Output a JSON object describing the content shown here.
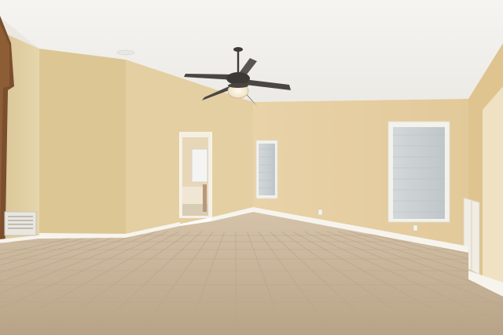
{
  "scene": {
    "type": "empty-room-photo",
    "room": "empty bedroom",
    "colors": {
      "ceiling": "#f2f1ee",
      "wall": "#e6cfa3",
      "wall_shadow": "#d8c190",
      "left_wall": "#ddc995",
      "baseboard": "#f7f4ee",
      "floor_light": "#cbb89e",
      "floor_dark": "#9e8c74",
      "grout": "#b8a68c",
      "window_frame": "#f4f2ec",
      "window_blind": "#c9d0d3",
      "fan_blade": "#4a4644",
      "fan_light": "#f7efd9",
      "vent": "#e9e6df",
      "doorway_tub": "#efe9dd"
    },
    "objects": [
      {
        "name": "ceiling-fan",
        "kind": "ceiling fan with light kit"
      },
      {
        "name": "window-left",
        "kind": "window with closed blind"
      },
      {
        "name": "window-right",
        "kind": "window with closed blind"
      },
      {
        "name": "doorway",
        "kind": "open doorway to bathroom"
      },
      {
        "name": "floor-vent",
        "kind": "wall air vent"
      },
      {
        "name": "closet-doors",
        "kind": "white closet bifold doors"
      },
      {
        "name": "tile-floor",
        "kind": "travertine tile floor"
      }
    ]
  }
}
